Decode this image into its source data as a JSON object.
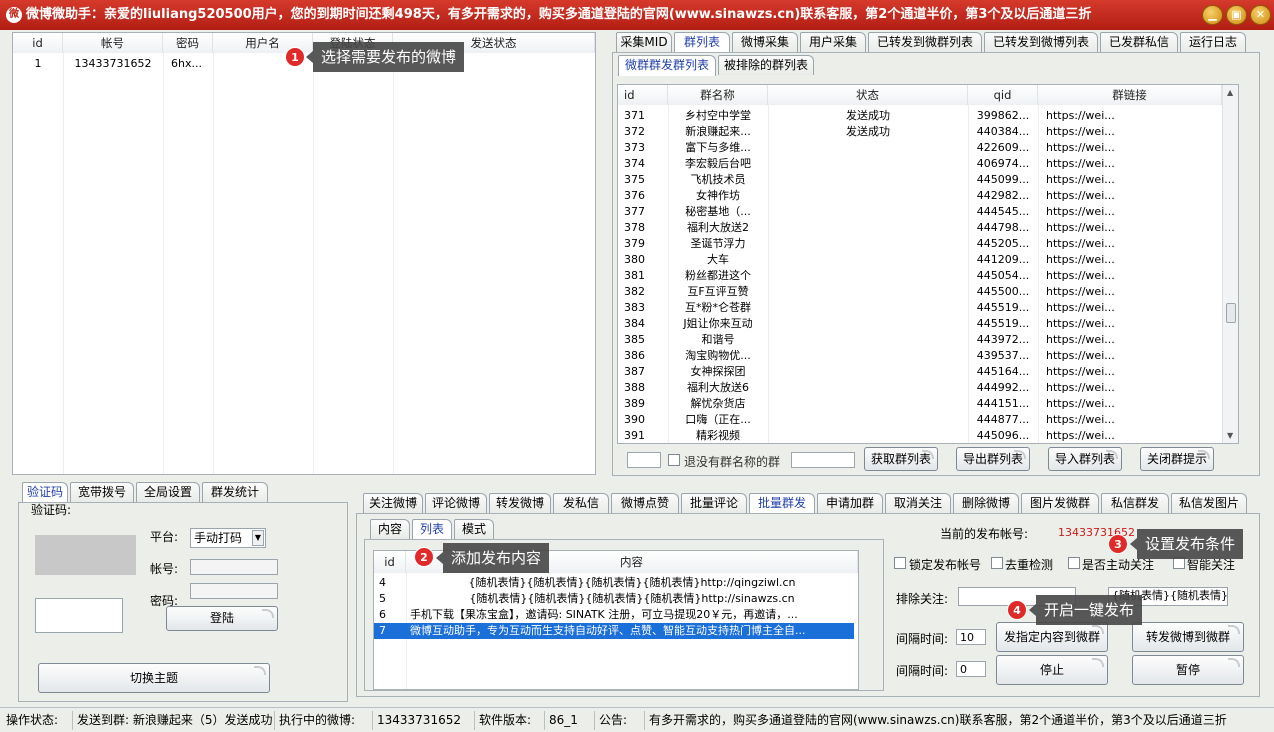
{
  "window": {
    "title": "微博微助手：亲爱的liuliang520500用户，您的到期时间还剩498天，有多开需求的，购买多通道登陆的官网(www.sinawzs.cn)联系客服，第2个通道半价，第3个及以后通道三折",
    "minimize": "▁",
    "maximize": "▣",
    "close": "✕"
  },
  "accounts": {
    "columns": [
      "id",
      "帐号",
      "密码",
      "用户名",
      "登陆状态",
      "发送状态"
    ],
    "rows": [
      {
        "id": "1",
        "account": "13433731652",
        "password": "6hx...",
        "username": "",
        "login": "",
        "send": ""
      }
    ]
  },
  "top_tabs": [
    "采集MID",
    "群列表",
    "微博采集",
    "用户采集",
    "已转发到微群列表",
    "已转发到微博列表",
    "已发群私信",
    "运行日志"
  ],
  "group_subtabs": [
    "微群群发群列表",
    "被排除的群列表"
  ],
  "groups": {
    "columns": [
      "id",
      "群名称",
      "状态",
      "qid",
      "群链接"
    ],
    "rows": [
      {
        "id": "371",
        "name": "乡村空中学堂",
        "status": "发送成功",
        "qid": "399862...",
        "link": "https://wei..."
      },
      {
        "id": "372",
        "name": "新浪赚起来...",
        "status": "发送成功",
        "qid": "440384...",
        "link": "https://wei..."
      },
      {
        "id": "373",
        "name": "富下与多维...",
        "status": "",
        "qid": "422609...",
        "link": "https://wei..."
      },
      {
        "id": "374",
        "name": "李宏毅后台吧",
        "status": "",
        "qid": "406974...",
        "link": "https://wei..."
      },
      {
        "id": "375",
        "name": "飞机技术员",
        "status": "",
        "qid": "445099...",
        "link": "https://wei..."
      },
      {
        "id": "376",
        "name": "女神作坊",
        "status": "",
        "qid": "442982...",
        "link": "https://wei..."
      },
      {
        "id": "377",
        "name": "秘密基地（...",
        "status": "",
        "qid": "444545...",
        "link": "https://wei..."
      },
      {
        "id": "378",
        "name": "福利大放送2",
        "status": "",
        "qid": "444798...",
        "link": "https://wei..."
      },
      {
        "id": "379",
        "name": "圣诞节浮力",
        "status": "",
        "qid": "445205...",
        "link": "https://wei..."
      },
      {
        "id": "380",
        "name": "大车",
        "status": "",
        "qid": "441209...",
        "link": "https://wei..."
      },
      {
        "id": "381",
        "name": "粉丝都进这个",
        "status": "",
        "qid": "445054...",
        "link": "https://wei..."
      },
      {
        "id": "382",
        "name": "互F互评互赞",
        "status": "",
        "qid": "445500...",
        "link": "https://wei..."
      },
      {
        "id": "383",
        "name": "互*粉*仑苍群",
        "status": "",
        "qid": "445519...",
        "link": "https://wei..."
      },
      {
        "id": "384",
        "name": "J姐让你来互动",
        "status": "",
        "qid": "445519...",
        "link": "https://wei..."
      },
      {
        "id": "385",
        "name": "和谐号",
        "status": "",
        "qid": "443972...",
        "link": "https://wei..."
      },
      {
        "id": "386",
        "name": "淘宝购物优...",
        "status": "",
        "qid": "439537...",
        "link": "https://wei..."
      },
      {
        "id": "387",
        "name": "女神探探团",
        "status": "",
        "qid": "445164...",
        "link": "https://wei..."
      },
      {
        "id": "388",
        "name": "福利大放送6",
        "status": "",
        "qid": "444992...",
        "link": "https://wei..."
      },
      {
        "id": "389",
        "name": "解忧杂货店",
        "status": "",
        "qid": "444151...",
        "link": "https://wei..."
      },
      {
        "id": "390",
        "name": "口嗨（正在...",
        "status": "",
        "qid": "444877...",
        "link": "https://wei..."
      },
      {
        "id": "391",
        "name": "精彩视频",
        "status": "",
        "qid": "445096...",
        "link": "https://wei..."
      }
    ]
  },
  "group_toolbar": {
    "exit_no_name": "退没有群名称的群",
    "get_list": "获取群列表",
    "export": "导出群列表",
    "import": "导入群列表",
    "close_tip": "关闭群提示"
  },
  "left_tabs": [
    "验证码",
    "宽带拨号",
    "全局设置",
    "群发统计"
  ],
  "captcha": {
    "group_title": "验证码:",
    "platform_label": "平台:",
    "platform_value": "手动打码",
    "account_label": "帐号:",
    "password_label": "密码:",
    "login": "登陆",
    "switch_theme": "切换主题"
  },
  "func_tabs": [
    "关注微博",
    "评论微博",
    "转发微博",
    "发私信",
    "微博点赞",
    "批量评论",
    "批量群发",
    "申请加群",
    "取消关注",
    "删除微博",
    "图片发微群",
    "私信群发",
    "私信发图片"
  ],
  "content_tabs": [
    "内容",
    "列表",
    "模式"
  ],
  "content": {
    "columns": [
      "id",
      "内容"
    ],
    "rows": [
      {
        "id": "4",
        "text": "{随机表情}{随机表情}{随机表情}{随机表情}http://qingziwl.cn"
      },
      {
        "id": "5",
        "text": "{随机表情}{随机表情}{随机表情}{随机表情}http://sinawzs.cn"
      },
      {
        "id": "6",
        "text": "手机下载【果冻宝盒】，邀请码: SINATK  注册，可立马提现20￥元，再邀请，..."
      },
      {
        "id": "7",
        "text": "微博互动助手，专为互动而生支持自动好评、点赞、智能互动支持热门博主全自..."
      }
    ]
  },
  "settings": {
    "current_label": "当前的发布帐号:",
    "current_value": "13433731652",
    "lock_account": "锁定发布帐号",
    "dedupe": "去重检测",
    "auto_follow": "是否主动关注",
    "smart_follow": "智能关注",
    "exclude_label": "排除关注:",
    "emoji_value": "{随机表情}{随机表情}",
    "interval1_label": "间隔时间:",
    "interval1_value": "10",
    "interval2_label": "间隔时间:",
    "interval2_value": "0",
    "send_to_group": "发指定内容到微群",
    "forward_to_group": "转发微博到微群",
    "stop": "停止",
    "pause": "暂停"
  },
  "callouts": [
    {
      "num": "1",
      "text": "选择需要发布的微博"
    },
    {
      "num": "2",
      "text": "添加发布内容"
    },
    {
      "num": "3",
      "text": "设置发布条件"
    },
    {
      "num": "4",
      "text": "开启一键发布"
    }
  ],
  "statusbar": {
    "op_label": "操作状态:",
    "op_value": "发送到群: 新浪赚起来（5）发送成功",
    "exec_label": "执行中的微博:",
    "exec_value": "13433731652",
    "ver_label": "软件版本:",
    "ver_value": "86_1",
    "notice_label": "公告:",
    "notice_value": "有多开需求的，购买多通道登陆的官网(www.sinawzs.cn)联系客服，第2个通道半价，第3个及以后通道三折"
  },
  "colors": {
    "title_bar": "#c62a1d",
    "accent_red": "#e02a2a",
    "selected_row": "#1b6fd8"
  }
}
